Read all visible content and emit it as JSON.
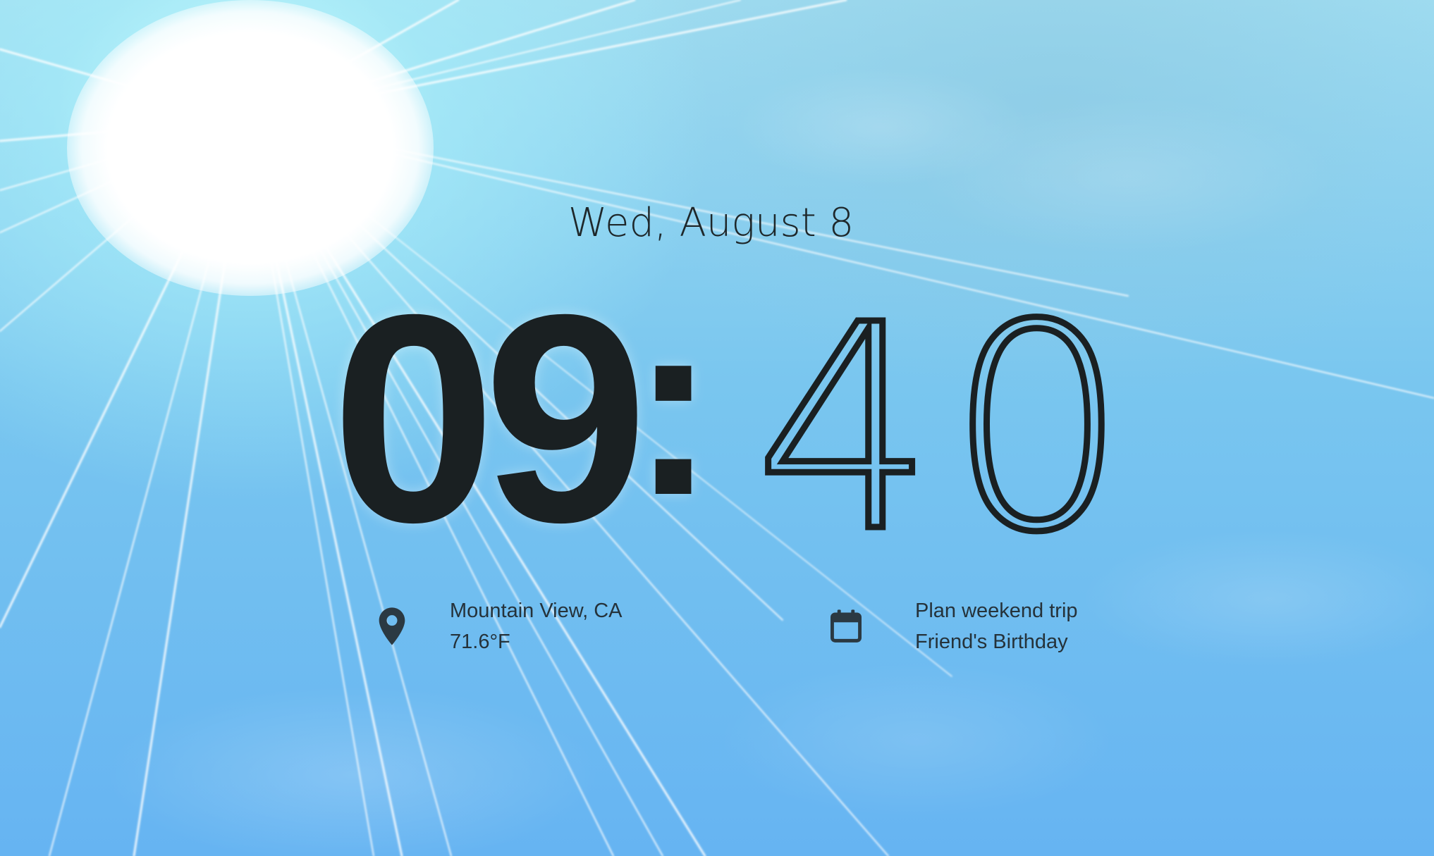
{
  "date": "Wed, August 8",
  "clock": {
    "hours": "09",
    "separator": ":",
    "minutes": "40"
  },
  "weather": {
    "icon": "location-pin-icon",
    "location": "Mountain View, CA",
    "temperature": "71.6°F"
  },
  "tasks": {
    "icon": "calendar-icon",
    "items": [
      "Plan weekend trip",
      "Friend's Birthday"
    ]
  },
  "colors": {
    "text": "#1a2022",
    "sky_top": "#9fdcf0",
    "sky_bottom": "#66b4f2",
    "sun": "#ffffff"
  }
}
